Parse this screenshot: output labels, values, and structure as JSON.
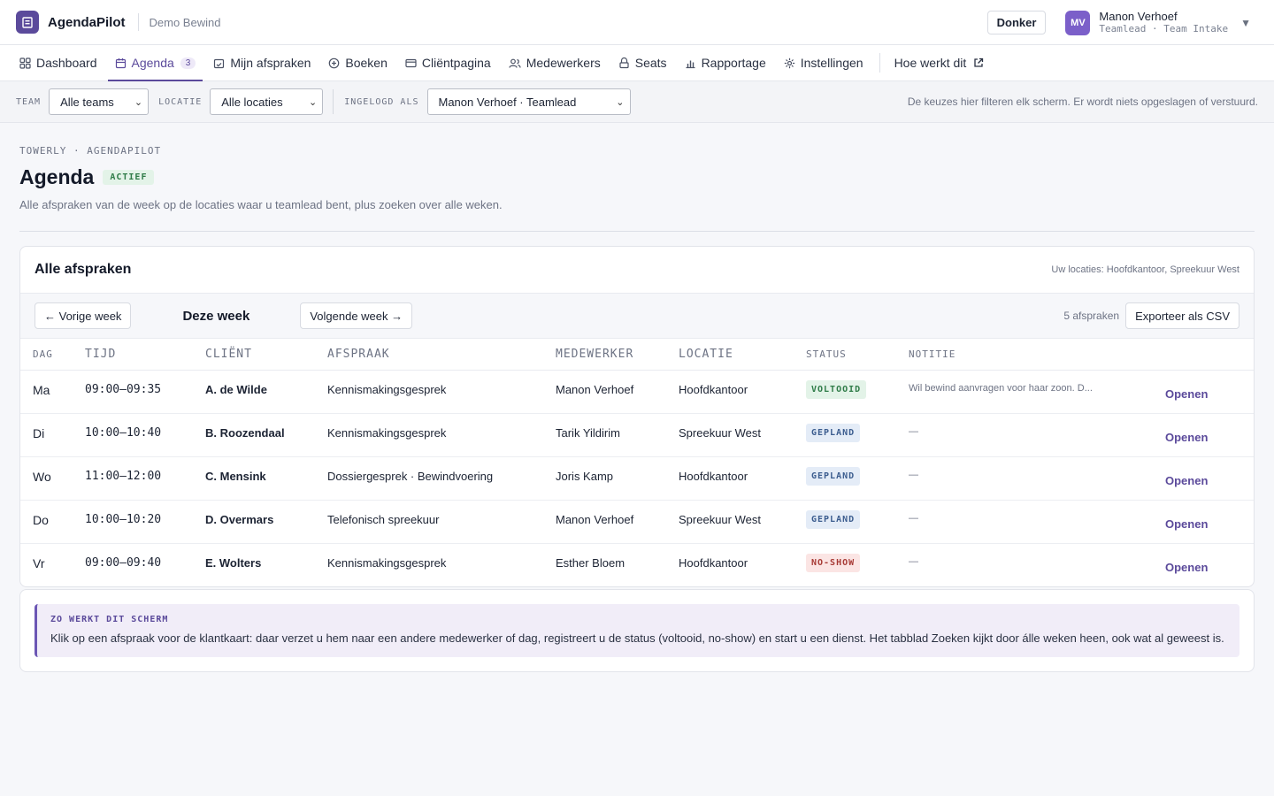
{
  "app": {
    "name": "AgendaPilot",
    "subtitle": "Demo Bewind"
  },
  "header": {
    "theme_button": "Donker",
    "user": {
      "initials": "MV",
      "name": "Manon Verhoef",
      "role": "Teamlead · Team Intake"
    }
  },
  "nav": {
    "items": [
      {
        "label": "Dashboard",
        "icon": "grid-icon"
      },
      {
        "label": "Agenda",
        "icon": "calendar-icon",
        "badge": "3",
        "active": true
      },
      {
        "label": "Mijn afspraken",
        "icon": "calendar-check-icon"
      },
      {
        "label": "Boeken",
        "icon": "plus-circle-icon"
      },
      {
        "label": "Cliëntpagina",
        "icon": "card-icon"
      },
      {
        "label": "Medewerkers",
        "icon": "users-icon"
      },
      {
        "label": "Seats",
        "icon": "seat-icon"
      },
      {
        "label": "Rapportage",
        "icon": "bar-chart-icon"
      },
      {
        "label": "Instellingen",
        "icon": "gear-icon"
      }
    ],
    "help_link": "Hoe werkt dit"
  },
  "filters": {
    "team_label": "TEAM",
    "team_value": "Alle teams",
    "location_label": "LOCATIE",
    "location_value": "Alle locaties",
    "logged_in_label": "INGELOGD ALS",
    "logged_in_value": "Manon Verhoef · Teamlead",
    "note": "De keuzes hier filteren elk scherm. Er wordt niets opgeslagen of verstuurd."
  },
  "page": {
    "eyebrow": "TOWERLY · AGENDAPILOT",
    "title": "Agenda",
    "status_badge": "ACTIEF",
    "description": "Alle afspraken van de week op de locaties waar u teamlead bent, plus zoeken over alle weken."
  },
  "card": {
    "title": "Alle afspraken",
    "locations": "Uw locaties: Hoofdkantoor, Spreekuur West",
    "prev_week": "← Vorige week",
    "current_week": "Deze week",
    "next_week": "Volgende week →",
    "count": "5 afspraken",
    "export": "Exporteer als CSV",
    "columns": [
      "DAG",
      "TIJD",
      "CLIËNT",
      "AFSPRAAK",
      "MEDEWERKER",
      "LOCATIE",
      "STATUS",
      "NOTITIE"
    ],
    "open_label": "Openen",
    "rows": [
      {
        "day": "Ma",
        "time": "09:00–09:35",
        "client": "A. de Wilde",
        "appointment": "Kennismakingsgesprek",
        "employee": "Manon Verhoef",
        "location": "Hoofdkantoor",
        "status": "VOLTOOID",
        "status_type": "done",
        "note": "Wil bewind aanvragen voor haar zoon. D..."
      },
      {
        "day": "Di",
        "time": "10:00–10:40",
        "client": "B. Roozendaal",
        "appointment": "Kennismakingsgesprek",
        "employee": "Tarik Yildirim",
        "location": "Spreekuur West",
        "status": "GEPLAND",
        "status_type": "plan",
        "note": "—"
      },
      {
        "day": "Wo",
        "time": "11:00–12:00",
        "client": "C. Mensink",
        "appointment": "Dossiergesprek · Bewindvoering",
        "employee": "Joris Kamp",
        "location": "Hoofdkantoor",
        "status": "GEPLAND",
        "status_type": "plan",
        "note": "—"
      },
      {
        "day": "Do",
        "time": "10:00–10:20",
        "client": "D. Overmars",
        "appointment": "Telefonisch spreekuur",
        "employee": "Manon Verhoef",
        "location": "Spreekuur West",
        "status": "GEPLAND",
        "status_type": "plan",
        "note": "—"
      },
      {
        "day": "Vr",
        "time": "09:00–09:40",
        "client": "E. Wolters",
        "appointment": "Kennismakingsgesprek",
        "employee": "Esther Bloem",
        "location": "Hoofdkantoor",
        "status": "NO-SHOW",
        "status_type": "noshow",
        "note": "—"
      }
    ]
  },
  "help": {
    "eyebrow": "ZO WERKT DIT SCHERM",
    "text": "Klik op een afspraak voor de klantkaart: daar verzet u hem naar een andere medewerker of dag, registreert u de status (voltooid, no-show) en start u een dienst. Het tabblad Zoeken kijkt door álle weken heen, ook wat al geweest is."
  },
  "colors": {
    "accent": "#5b4a9b",
    "success": "#2e7b47",
    "planned": "#3c5d8f",
    "danger": "#a73a35"
  }
}
